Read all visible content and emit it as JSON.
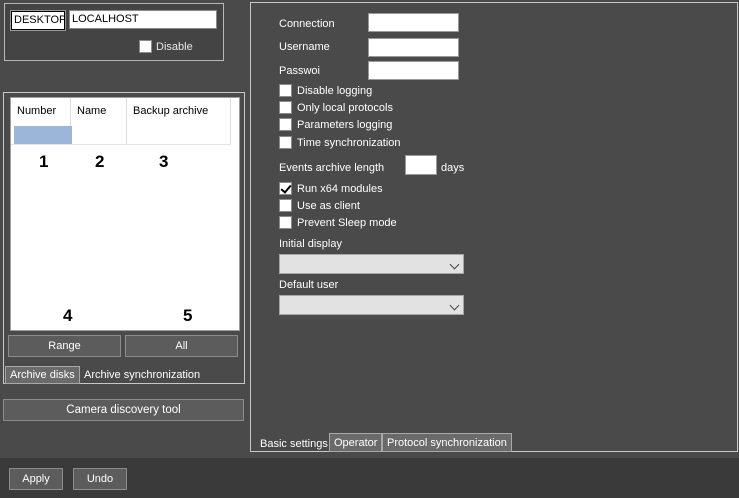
{
  "server": {
    "host_id": "DESKTOP",
    "host_name": "LOCALHOST",
    "disable_label": "Disable",
    "disable_checked": false
  },
  "archive": {
    "columns": [
      "Number",
      "Name",
      "Backup archive"
    ],
    "annotations": [
      "1",
      "2",
      "3",
      "4",
      "5"
    ],
    "range_button": "Range",
    "all_button": "All",
    "tabs": [
      "Archive disks",
      "Archive synchronization"
    ],
    "active_tab": "Archive disks"
  },
  "camera_discovery_button": "Camera discovery tool",
  "settings": {
    "connection_label": "Connection",
    "username_label": "Username",
    "password_label": "Passwoi",
    "checkboxes_top": [
      {
        "label": "Disable logging",
        "checked": false
      },
      {
        "label": "Only local protocols",
        "checked": false
      },
      {
        "label": "Parameters logging",
        "checked": false
      },
      {
        "label": "Time synchronization",
        "checked": false
      }
    ],
    "events_archive_label": "Events archive length",
    "events_archive_unit": "days",
    "checkboxes_bottom": [
      {
        "label": "Run x64 modules",
        "checked": true
      },
      {
        "label": "Use as client",
        "checked": false
      },
      {
        "label": "Prevent Sleep mode",
        "checked": false
      }
    ],
    "initial_display_label": "Initial display",
    "default_user_label": "Default user",
    "tabs": [
      "Basic settings",
      "Operator",
      "Protocol synchronization"
    ],
    "active_tab": "Basic settings"
  },
  "bottom": {
    "apply_button": "Apply",
    "undo_button": "Undo"
  }
}
